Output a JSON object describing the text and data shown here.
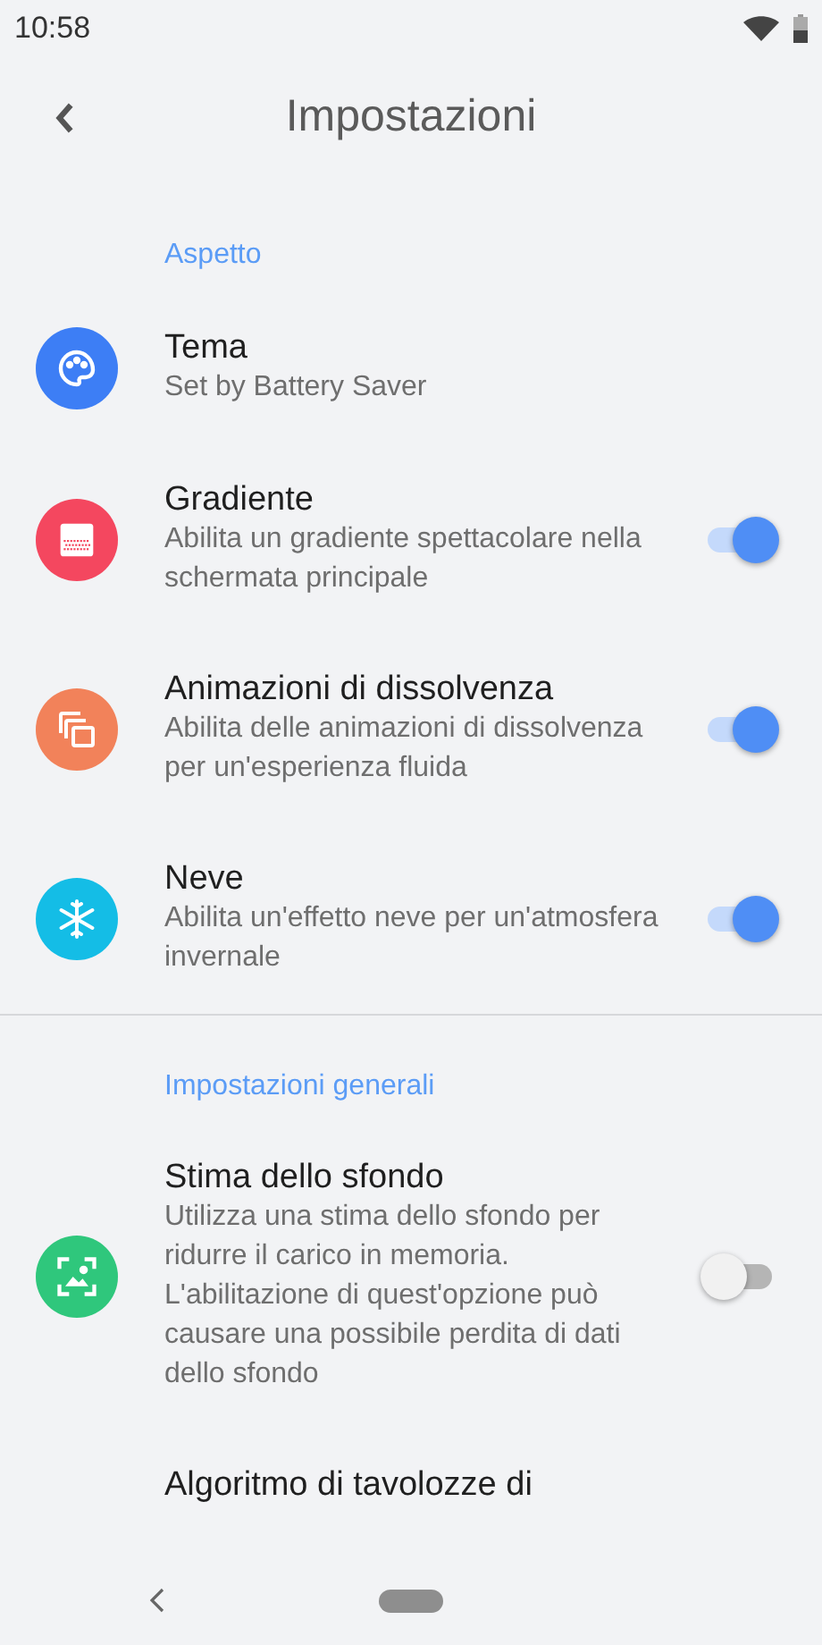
{
  "status_bar": {
    "time": "10:58"
  },
  "toolbar": {
    "title": "Impostazioni"
  },
  "sections": [
    {
      "header": "Aspetto",
      "items": [
        {
          "kind": "plain",
          "title": "Tema",
          "subtitle": "Set by Battery Saver",
          "color": "#3d7ef5"
        },
        {
          "kind": "toggle",
          "title": "Gradiente",
          "subtitle": "Abilita un gradiente spettacolare nella schermata principale",
          "color": "#f4475f",
          "on": true
        },
        {
          "kind": "toggle",
          "title": "Animazioni di dissolvenza",
          "subtitle": "Abilita delle animazioni di dissolvenza per un'esperienza fluida",
          "color": "#f2825a",
          "on": true
        },
        {
          "kind": "toggle",
          "title": "Neve",
          "subtitle": "Abilita un'effetto neve per un'atmosfera invernale",
          "color": "#14bde6",
          "on": true
        }
      ]
    },
    {
      "header": "Impostazioni generali",
      "items": [
        {
          "kind": "toggle",
          "title": "Stima dello sfondo",
          "subtitle": "Utilizza una stima dello sfondo per ridurre il carico in memoria. L'abilitazione di quest'opzione può causare una possibile perdita di dati dello sfondo",
          "color": "#2fc77c",
          "on": false
        },
        {
          "kind": "heading",
          "title": "Algoritmo di tavolozze di"
        }
      ]
    }
  ]
}
